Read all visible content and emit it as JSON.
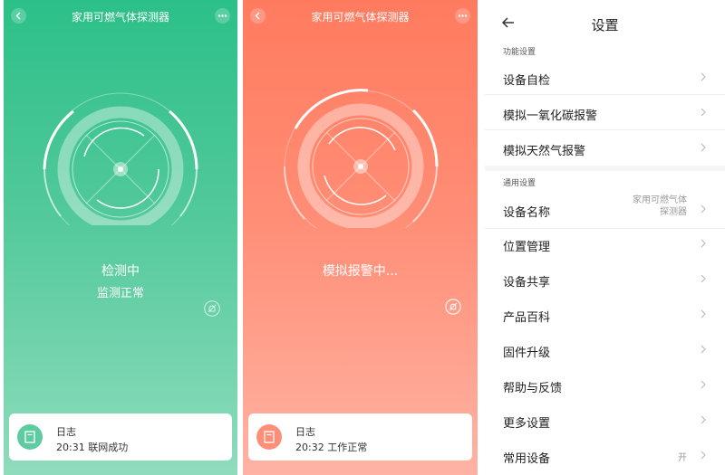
{
  "panel_detecting": {
    "title": "家用可燃气体探测器",
    "status_main": "检测中",
    "status_sub": "监测正常",
    "log_title": "日志",
    "log_entry": "20:31 联网成功",
    "accent": "#2cc089"
  },
  "panel_alarm": {
    "title": "家用可燃气体探测器",
    "status_main": "模拟报警中...",
    "log_title": "日志",
    "log_entry": "20:32 工作正常",
    "accent": "#ff7b5f"
  },
  "settings": {
    "title": "设置",
    "section_function": "功能设置",
    "self_check": "设备自检",
    "sim_co_alarm": "模拟一氧化碳报警",
    "sim_gas_alarm": "模拟天然气报警",
    "section_general": "通用设置",
    "device_name": "设备名称",
    "device_name_value_line1": "家用可燃气体",
    "device_name_value_line2": "探测器",
    "location": "位置管理",
    "share": "设备共享",
    "wiki": "产品百科",
    "firmware": "固件升级",
    "help": "帮助与反馈",
    "more": "更多设置",
    "common_device": "常用设备",
    "common_device_value": "开"
  },
  "icons": {
    "back": "back-arrow-icon",
    "more": "more-dots-icon",
    "mute": "bell-muted-icon",
    "log": "log-document-icon",
    "chevron": "chevron-right-icon"
  }
}
